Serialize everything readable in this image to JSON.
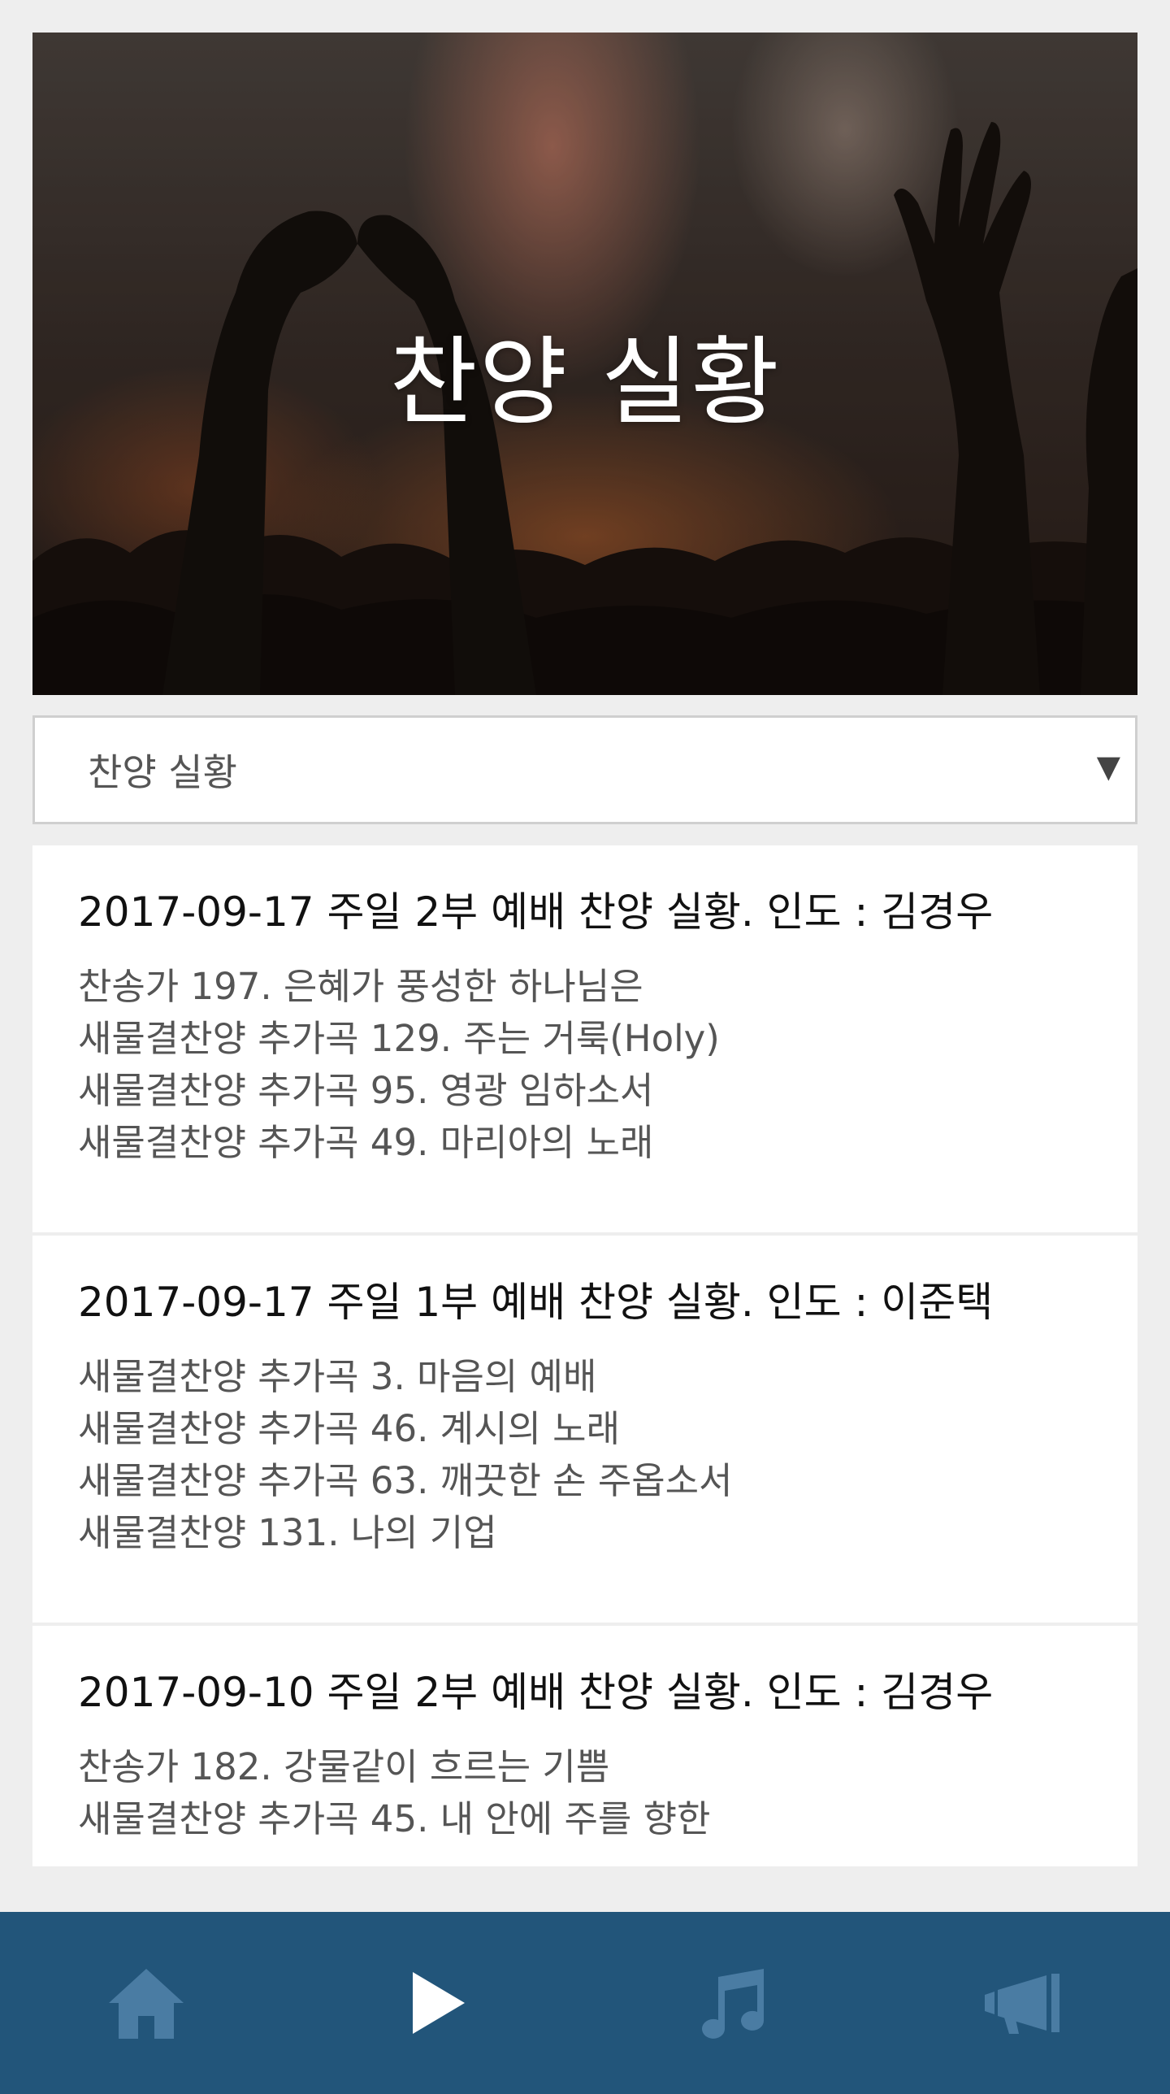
{
  "header": {
    "title": "찬양 실황"
  },
  "filter": {
    "selected": "찬양 실황",
    "arrow": "▼"
  },
  "posts": [
    {
      "title": "2017-09-17 주일 2부 예배 찬양 실황. 인도 : 김경우",
      "songs": [
        "찬송가 197. 은혜가 풍성한 하나님은",
        "새물결찬양 추가곡 129. 주는 거룩(Holy)",
        "새물결찬양 추가곡 95. 영광 임하소서",
        "새물결찬양 추가곡 49. 마리아의 노래"
      ]
    },
    {
      "title": "2017-09-17 주일 1부 예배 찬양 실황. 인도 : 이준택",
      "songs": [
        "새물결찬양 추가곡 3. 마음의 예배",
        "새물결찬양 추가곡 46. 계시의 노래",
        "새물결찬양 추가곡 63. 깨끗한 손 주옵소서",
        "새물결찬양 131. 나의 기업"
      ]
    },
    {
      "title": "2017-09-10 주일 2부 예배 찬양 실황. 인도 : 김경우",
      "songs": [
        "찬송가 182. 강물같이 흐르는 기쁨",
        "새물결찬양 추가곡 45. 내 안에 주를 향한"
      ]
    }
  ],
  "tabs": [
    {
      "icon": "home-icon",
      "active": false
    },
    {
      "icon": "play-icon",
      "active": true
    },
    {
      "icon": "music-note-icon",
      "active": false
    },
    {
      "icon": "megaphone-icon",
      "active": false
    }
  ],
  "colors": {
    "tabbar_bg": "#22557a",
    "tab_active": "#ffffff",
    "tab_inactive": "#4a7ca3"
  }
}
